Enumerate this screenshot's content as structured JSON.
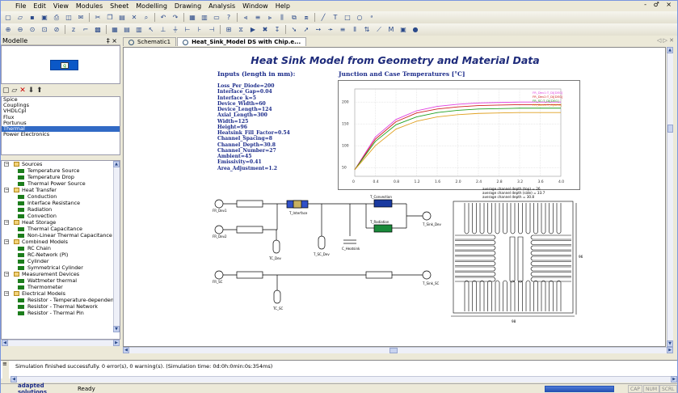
{
  "menu": [
    "File",
    "Edit",
    "View",
    "Modules",
    "Sheet",
    "Modelling",
    "Drawing",
    "Analysis",
    "Window",
    "Help"
  ],
  "window_controls": "- ♂ ×",
  "panels": {
    "modelle_title": "Modelle",
    "pin_glyph": "‡ ×",
    "library_list": [
      "Spice",
      "Couplings",
      "VHDLCpl",
      "Flux",
      "Portunus",
      "Thermal",
      "Power Electronics"
    ],
    "library_selected": "Thermal"
  },
  "tree": [
    {
      "type": "group",
      "label": "Sources"
    },
    {
      "type": "leaf",
      "label": "Temperature Source"
    },
    {
      "type": "leaf",
      "label": "Temperature Drop"
    },
    {
      "type": "leaf",
      "label": "Thermal Power Source"
    },
    {
      "type": "group",
      "label": "Heat Transfer"
    },
    {
      "type": "leaf",
      "label": "Conduction"
    },
    {
      "type": "leaf",
      "label": "Interface Resistance"
    },
    {
      "type": "leaf",
      "label": "Radiation"
    },
    {
      "type": "leaf",
      "label": "Convection"
    },
    {
      "type": "group",
      "label": "Heat Storage"
    },
    {
      "type": "leaf",
      "label": "Thermal Capacitance"
    },
    {
      "type": "leaf",
      "label": "Non-Linear Thermal Capacitance"
    },
    {
      "type": "group",
      "label": "Combined Models"
    },
    {
      "type": "leaf",
      "label": "RC Chain"
    },
    {
      "type": "leaf",
      "label": "RC-Network (PI)"
    },
    {
      "type": "leaf",
      "label": "Cylinder"
    },
    {
      "type": "leaf",
      "label": "Symmetrical Cylinder"
    },
    {
      "type": "group",
      "label": "Measurement Devices"
    },
    {
      "type": "leaf",
      "label": "Wattmeter thermal"
    },
    {
      "type": "leaf",
      "label": "Thermometer"
    },
    {
      "type": "group",
      "label": "Electrical Models"
    },
    {
      "type": "leaf",
      "label": "Resistor - Temperature-dependent"
    },
    {
      "type": "leaf",
      "label": "Resistor - Thermal Network"
    },
    {
      "type": "leaf",
      "label": "Resistor - Thermal Pin"
    }
  ],
  "tabs": [
    {
      "label": "Schematic1",
      "active": false
    },
    {
      "label": "Heat_Sink_Model DS with Chip.e...",
      "active": true
    }
  ],
  "tab_nav": "◁ ▷ ✕",
  "sheet": {
    "title": "Heat Sink Model from Geometry and Material Data",
    "params_heading": "Inputs (length in mm):",
    "params": [
      "Loss_Per_Diode=200",
      "Interface_Gap=0.04",
      "Interface_k=5",
      "Device_Width=60",
      "Device_Length=124",
      "Axial_Length=300",
      "Width=125",
      "Height=96",
      "Heatsink_Fill_Factor=0.54",
      "Channel_Spacing=8",
      "Channel_Depth=30.8",
      "Channel_Number=27",
      "Ambient=45",
      "Emissivity=0.41",
      "Area_Adjustment=1.2"
    ],
    "plot_heading": "Junction and Case Temperatures [°C]",
    "drawing_notes": [
      "average channel depth (top) = 26",
      "average channel depth (side) = 33.7",
      "average channel depth = 30.8"
    ]
  },
  "chart_data": {
    "type": "line",
    "title": "Junction and Case Temperatures [°C]",
    "x_ticks": [
      "0",
      "0.4",
      "0.8",
      "1.2",
      "1.6",
      "2.0",
      "2.4",
      "2.8",
      "3.2",
      "3.6",
      "4.0"
    ],
    "y_ticks": [
      "200",
      "150",
      "100",
      "50"
    ],
    "ylim": [
      30,
      230
    ],
    "legend": [
      "FR_Dev1:T_DJ[DEG]",
      "FR_Dev2:T_DJ[DEG]",
      "FR_SC:T_DJ[DEG]",
      "FR_Dev1:T_C[DEG]"
    ],
    "series": [
      {
        "name": "FR_Dev1:T_DJ[DEG]",
        "color": "#e040e0",
        "values": [
          45,
          120,
          160,
          180,
          190,
          195,
          198,
          199,
          200,
          200,
          200
        ]
      },
      {
        "name": "FR_Dev2:T_DJ[DEG]",
        "color": "#d02020",
        "values": [
          45,
          115,
          155,
          175,
          184,
          189,
          192,
          193,
          194,
          194,
          194
        ]
      },
      {
        "name": "FR_SC:T_DJ[DEG]",
        "color": "#20a020",
        "values": [
          45,
          110,
          148,
          166,
          176,
          181,
          184,
          185,
          186,
          186,
          186
        ]
      },
      {
        "name": "FR_Dev1:T_C[DEG]",
        "color": "#e0a020",
        "values": [
          45,
          100,
          138,
          156,
          166,
          171,
          174,
          175,
          176,
          176,
          176
        ]
      }
    ]
  },
  "schematic_labels": {
    "fr1": "FR_Dev1",
    "fr2": "FR_Dev2",
    "fr3": "FR_SC",
    "tc1": "TC_Dev",
    "tc2": "T_SC_Dev",
    "ch": "C_Heatsink",
    "tint": "T_Interface",
    "tconv": "T_Convection",
    "trad": "T_Radiation",
    "th1": "T_Sink_Dev",
    "th2": "T_Sink_SC",
    "tcsc": "TC_SC",
    "w": "98",
    "h": "96"
  },
  "messages": {
    "line": "Simulation finished successfully.  0 error(s), 0 warning(s). (Simulation time: 0d:0h:0min:0s:354ms)"
  },
  "status": {
    "brand": "adapted solutions",
    "ready": "Ready",
    "cap": "CAP",
    "num": "NUM",
    "scrl": "SCRL"
  }
}
